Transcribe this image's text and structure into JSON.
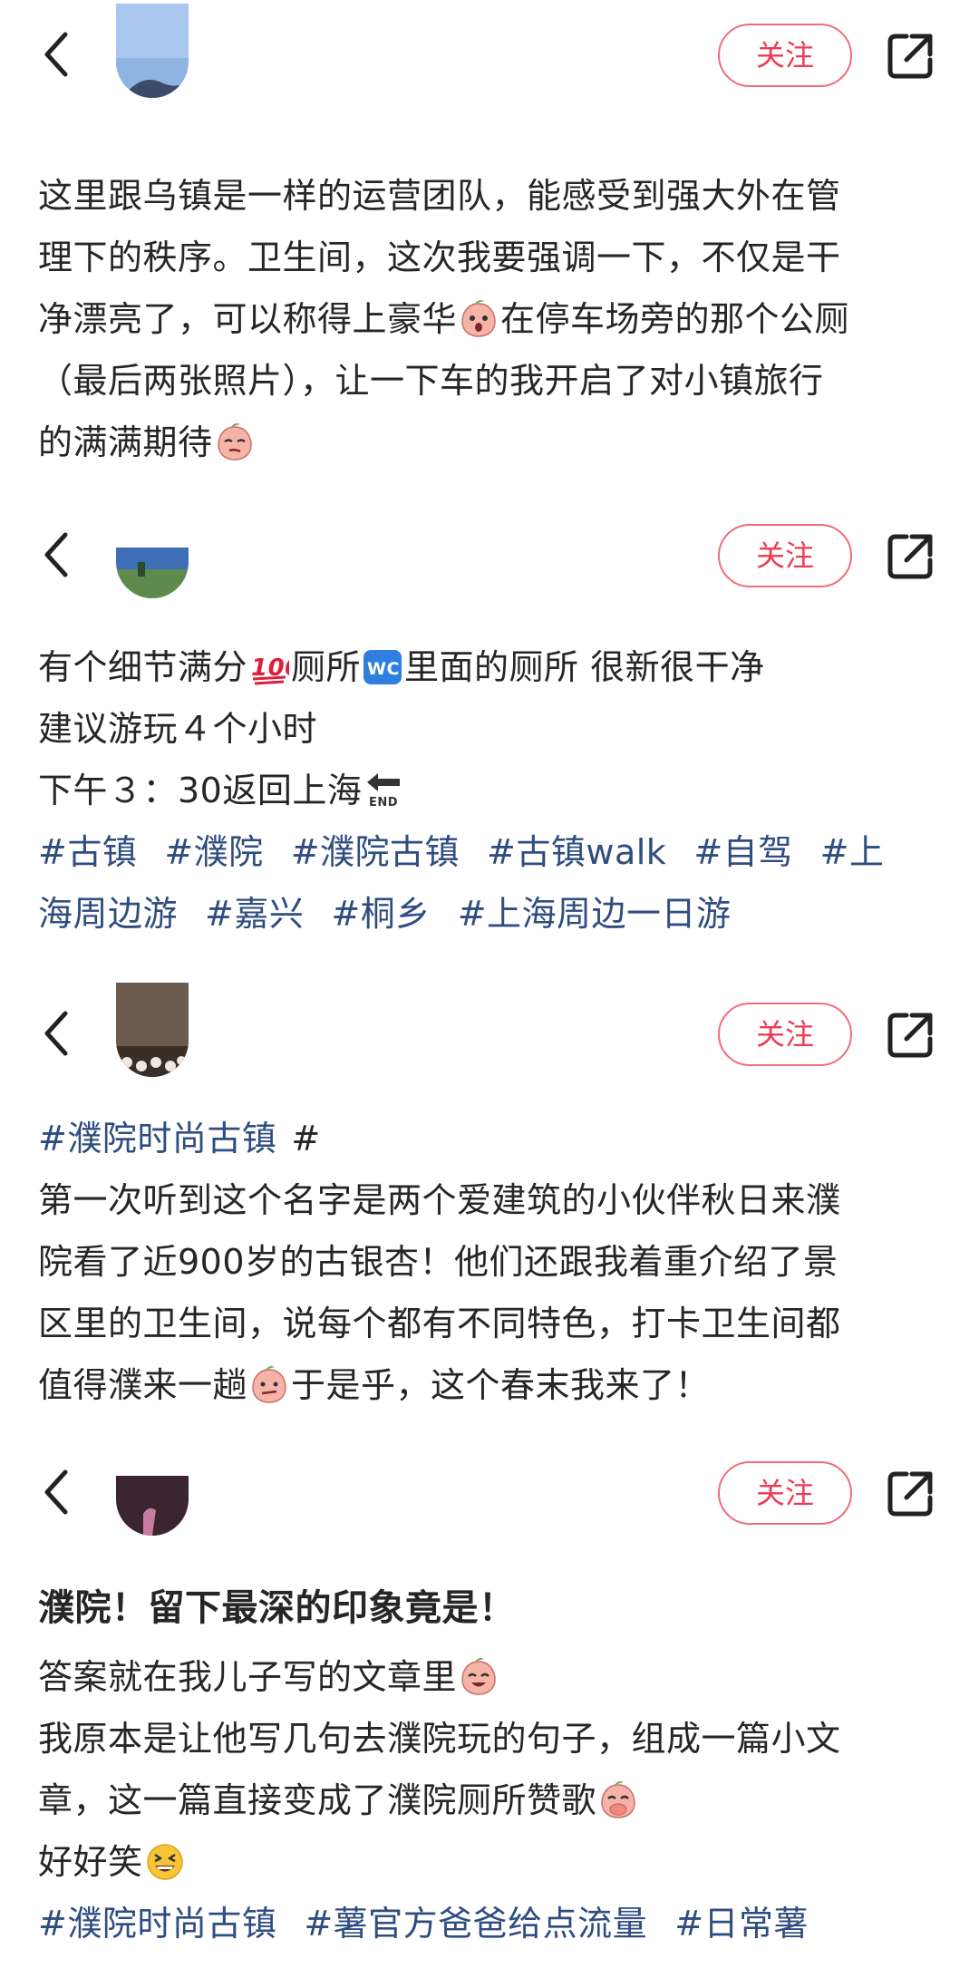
{
  "follow_label": "关注",
  "posts": [
    {
      "lines": [
        {
          "segments": [
            {
              "type": "text",
              "text": "这里跟乌镇是一样的运营团队，能感受到强大外在管"
            }
          ]
        },
        {
          "segments": [
            {
              "type": "text",
              "text": "理下的秩序。卫生间，这次我要强调一下，不仅是干"
            }
          ]
        },
        {
          "segments": [
            {
              "type": "text",
              "text": "净漂亮了，可以称得上豪华"
            },
            {
              "type": "emoji",
              "name": "peach-shocked-emoji"
            },
            {
              "type": "text",
              "text": "在停车场旁的那个公厕"
            }
          ]
        },
        {
          "segments": [
            {
              "type": "text",
              "text": "（最后两张照片），让一下车的我开启了对小镇旅行"
            }
          ]
        },
        {
          "segments": [
            {
              "type": "text",
              "text": "的满满期待"
            },
            {
              "type": "emoji",
              "name": "peach-smug-emoji"
            }
          ]
        }
      ]
    },
    {
      "lines": [
        {
          "segments": [
            {
              "type": "text",
              "text": "有个细节满分"
            },
            {
              "type": "emoji",
              "name": "hundred-points-emoji"
            },
            {
              "type": "text",
              "text": "厕所"
            },
            {
              "type": "emoji",
              "name": "wc-emoji"
            },
            {
              "type": "text",
              "text": "里面的厕所 很新很干净"
            }
          ]
        },
        {
          "segments": [
            {
              "type": "text",
              "text": "建议游玩４个小时"
            }
          ]
        },
        {
          "segments": [
            {
              "type": "text",
              "text": "下午３：30返回上海"
            },
            {
              "type": "emoji",
              "name": "end-arrow-emoji"
            }
          ]
        }
      ],
      "tag_lines": [
        [
          "#古镇",
          "#濮院",
          "#濮院古镇",
          "#古镇walk",
          "#自驾",
          "#上"
        ],
        [
          "海周边游",
          "#嘉兴",
          "#桐乡",
          "#上海周边一日游"
        ]
      ]
    },
    {
      "lines": [
        {
          "segments": [
            {
              "type": "tag",
              "text": "#濮院时尚古镇"
            },
            {
              "type": "text",
              "text": "#"
            }
          ]
        },
        {
          "segments": [
            {
              "type": "text",
              "text": "第一次听到这个名字是两个爱建筑的小伙伴秋日来濮"
            }
          ]
        },
        {
          "segments": [
            {
              "type": "text",
              "text": "院看了近900岁的古银杏！他们还跟我着重介绍了景"
            }
          ]
        },
        {
          "segments": [
            {
              "type": "text",
              "text": "区里的卫生间，说每个都有不同特色，打卡卫生间都"
            }
          ]
        },
        {
          "segments": [
            {
              "type": "text",
              "text": "值得濮来一趟"
            },
            {
              "type": "emoji",
              "name": "peach-pout-emoji"
            },
            {
              "type": "text",
              "text": "于是乎，这个春末我来了！"
            }
          ]
        }
      ]
    },
    {
      "title": "濮院！留下最深的印象竟是！",
      "lines": [
        {
          "segments": [
            {
              "type": "text",
              "text": "答案就在我儿子写的文章里"
            },
            {
              "type": "emoji",
              "name": "peach-laugh-emoji"
            }
          ]
        },
        {
          "segments": [
            {
              "type": "text",
              "text": "我原本是让他写几句去濮院玩的句子，组成一篇小文"
            }
          ]
        },
        {
          "segments": [
            {
              "type": "text",
              "text": "章，这一篇直接变成了濮院厕所赞歌"
            },
            {
              "type": "emoji",
              "name": "peach-cover-mouth-emoji"
            }
          ]
        },
        {
          "segments": [
            {
              "type": "text",
              "text": "好好笑"
            },
            {
              "type": "emoji",
              "name": "grinning-squint-emoji"
            }
          ]
        }
      ],
      "tag_lines": [
        [
          "#濮院时尚古镇",
          "#薯官方爸爸给点流量",
          "#日常薯"
        ]
      ]
    }
  ]
}
